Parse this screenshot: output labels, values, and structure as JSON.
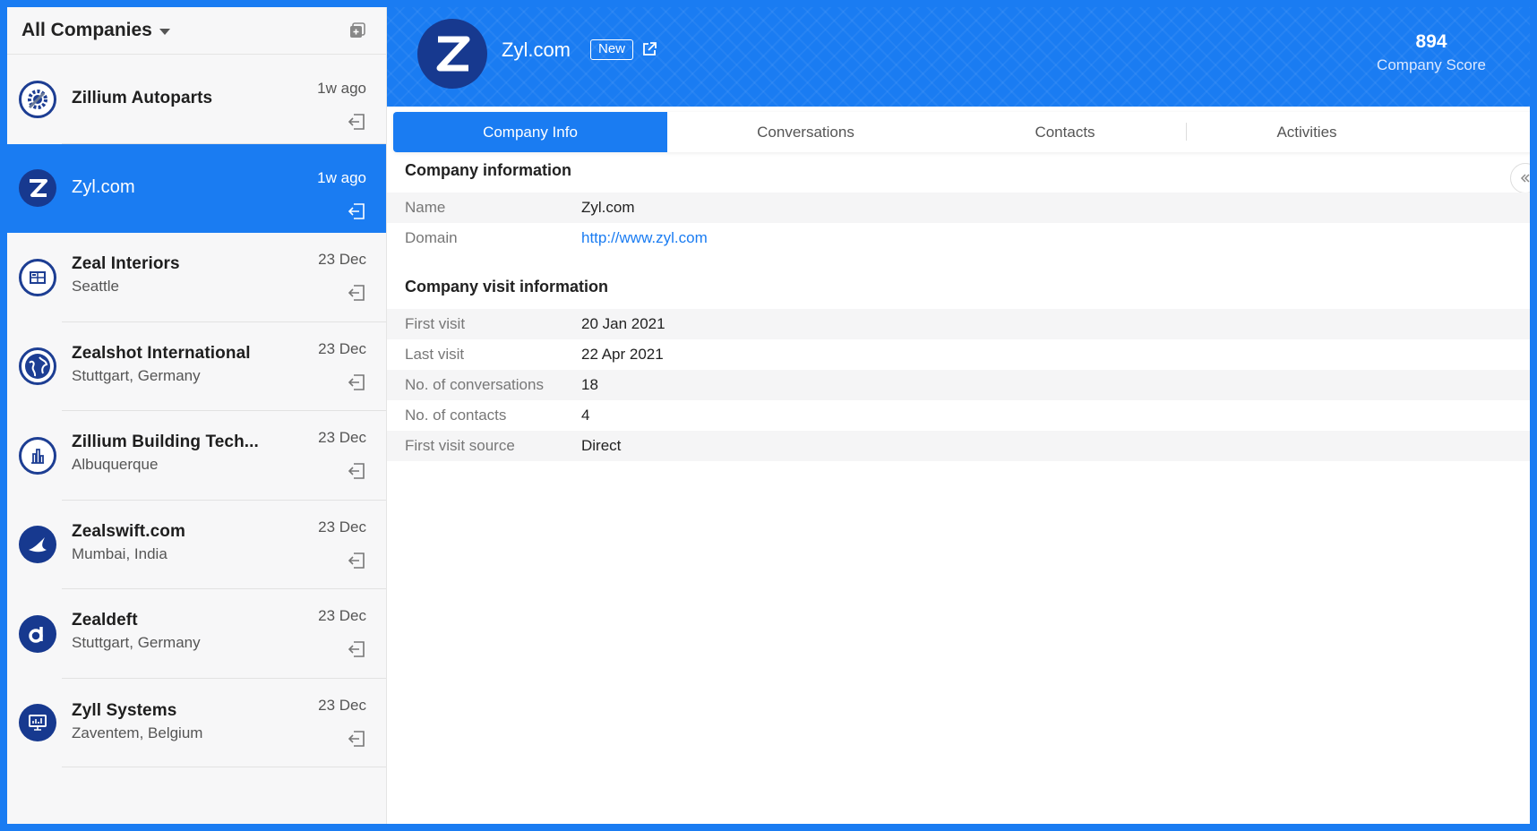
{
  "sidebar": {
    "title": "All Companies",
    "companies": [
      {
        "name": "Zillium Autoparts",
        "location": "",
        "time": "1w ago",
        "logo": "gear-wrench-icon"
      },
      {
        "name": "Zyl.com",
        "location": "",
        "time": "1w ago",
        "logo": "z-letter-icon",
        "active": true
      },
      {
        "name": "Zeal Interiors",
        "location": "Seattle",
        "time": "23 Dec",
        "logo": "floorplan-icon"
      },
      {
        "name": "Zealshot International",
        "location": "Stuttgart, Germany",
        "time": "23 Dec",
        "logo": "globe-icon"
      },
      {
        "name": "Zillium Building Tech...",
        "location": "Albuquerque",
        "time": "23 Dec",
        "logo": "building-icon"
      },
      {
        "name": "Zealswift.com",
        "location": "Mumbai, India",
        "time": "23 Dec",
        "logo": "swift-bird-icon"
      },
      {
        "name": "Zealdeft",
        "location": "Stuttgart, Germany",
        "time": "23 Dec",
        "logo": "d-letter-icon"
      },
      {
        "name": "Zyll Systems",
        "location": "Zaventem, Belgium",
        "time": "23 Dec",
        "logo": "monitor-icon"
      }
    ]
  },
  "header": {
    "company_name": "Zyl.com",
    "badge": "New",
    "score_value": "894",
    "score_label": "Company Score"
  },
  "tabs": [
    {
      "label": "Company Info",
      "active": true
    },
    {
      "label": "Conversations"
    },
    {
      "label": "Contacts"
    },
    {
      "label": "Activities"
    }
  ],
  "company_info": {
    "title": "Company information",
    "rows": [
      {
        "label": "Name",
        "value": "Zyl.com"
      },
      {
        "label": "Domain",
        "value": "http://www.zyl.com"
      }
    ]
  },
  "visit_info": {
    "title": "Company visit information",
    "rows": [
      {
        "label": "First visit",
        "value": "20 Jan 2021"
      },
      {
        "label": "Last visit",
        "value": "22 Apr 2021"
      },
      {
        "label": "No. of conversations",
        "value": "18"
      },
      {
        "label": "No. of contacts",
        "value": "4"
      },
      {
        "label": "First visit source",
        "value": "Direct"
      }
    ]
  },
  "colors": {
    "accent": "#1a7cf2",
    "logo_navy": "#17398f"
  }
}
